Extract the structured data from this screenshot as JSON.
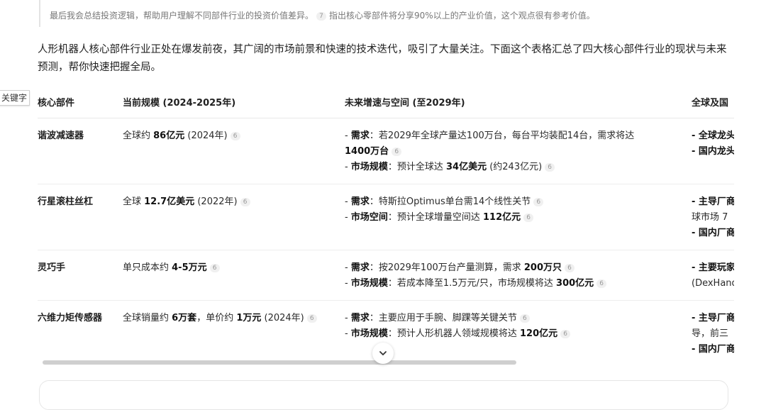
{
  "quote": {
    "text": "最后我会总结投资逻辑，帮助用户理解不同部件行业的投资价值差异。",
    "cite": "7",
    "text2": "指出核心零部件将分享90%以上的产业价值，这个观点很有参考价值。"
  },
  "intro": "人形机器人核心部件行业正处在爆发前夜，其广阔的市场前景和快速的技术迭代，吸引了大量关注。下面这个表格汇总了四大核心部件行业的现状与未来预测，帮你快速把握全局。",
  "tag": "关键字",
  "table": {
    "headers": [
      "核心部件",
      "当前规模 (2024-2025年)",
      "未来增速与空间 (至2029年)",
      "全球及国"
    ],
    "rows": [
      {
        "name": "谐波减速器",
        "scale": {
          "pre": "全球约 ",
          "bold": "86亿元",
          "post": " (2024年)",
          "cite": "6"
        },
        "future": [
          {
            "label": "需求",
            "t1": "：若2029年全球产量达100万台，每台平均装配14台，需求将达"
          },
          {
            "bold": "1400万台",
            "cite": "6"
          },
          {
            "label": "市场规模",
            "t1": "：预计全球达 ",
            "bold": "34亿美元",
            "t2": " (约243亿元)",
            "cite": "6"
          }
        ],
        "global": [
          "- 全球龙头",
          "- 国内龙头"
        ]
      },
      {
        "name": "行星滚柱丝杠",
        "scale": {
          "pre": "全球 ",
          "bold": "12.7亿美元",
          "post": " (2022年)",
          "cite": "6"
        },
        "future": [
          {
            "label": "需求",
            "t1": "：特斯拉Optimus单台需14个线性关节",
            "cite": "6"
          },
          {
            "label": "市场空间",
            "t1": "：预计全球增量空间达 ",
            "bold": "112亿元",
            "cite": "6"
          }
        ],
        "global": [
          "- 主导厂商",
          "球市场 7",
          "- 国内厂商"
        ]
      },
      {
        "name": "灵巧手",
        "scale": {
          "pre": "单只成本约 ",
          "bold": "4-5万元",
          "post": "",
          "cite": "6"
        },
        "future": [
          {
            "label": "需求",
            "t1": "：按2029年100万台产量测算，需求 ",
            "bold": "200万只",
            "cite": "6"
          },
          {
            "label": "市场规模",
            "t1": "：若成本降至1.5万元/只，市场规模将达 ",
            "bold": "300亿元",
            "cite": "6"
          }
        ],
        "global": [
          "- 主要玩家",
          "(DexHand"
        ]
      },
      {
        "name": "六维力矩传感器",
        "scale": {
          "pre": "全球销量约 ",
          "bold": "6万套",
          "post": "，单价约 ",
          "bold2": "1万元",
          "post2": " (2024年)",
          "cite": "6"
        },
        "future": [
          {
            "label": "需求",
            "t1": "：主要应用于手腕、脚踝等关键关节",
            "cite": "6"
          },
          {
            "label": "市场规模",
            "t1": "：预计人形机器人领域规模将达 ",
            "bold": "120亿元",
            "cite": "6"
          }
        ],
        "global": [
          "- 主导厂商",
          "导，前三",
          "- 国内厂商"
        ]
      }
    ]
  }
}
